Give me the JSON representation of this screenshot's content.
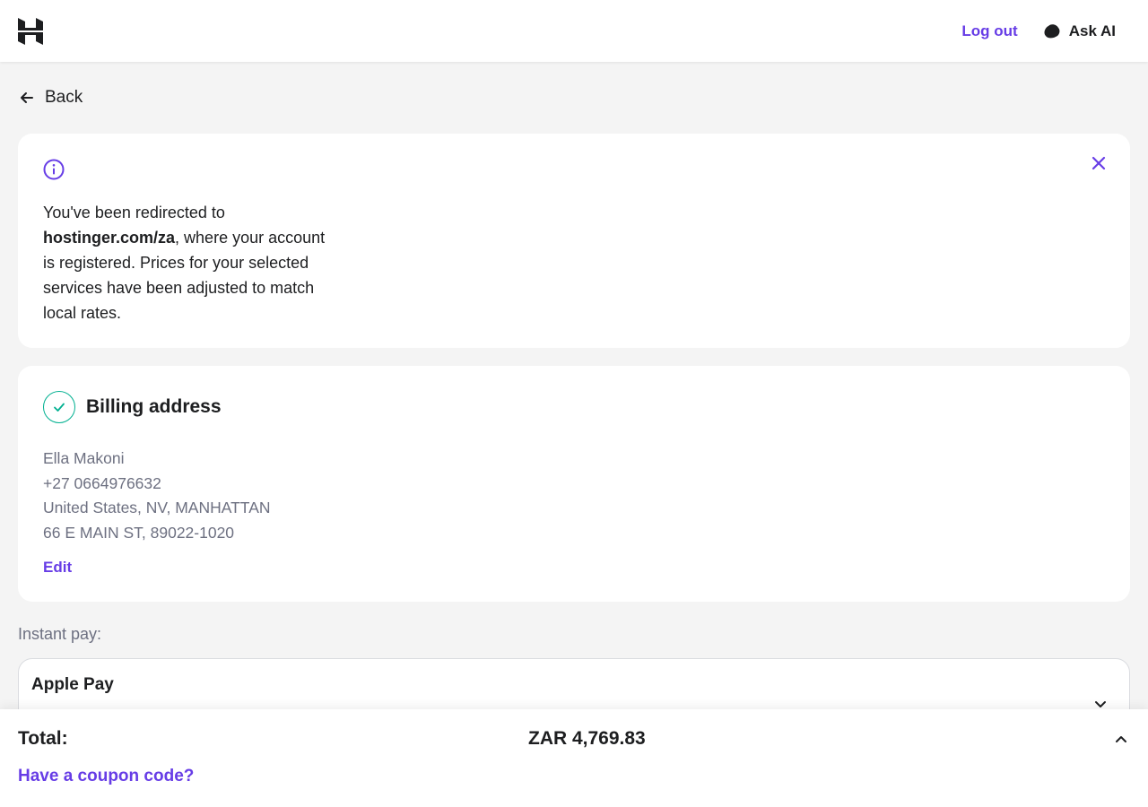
{
  "header": {
    "logo_icon": "hostinger-logo-icon",
    "logout_label": "Log out",
    "ask_ai_label": "Ask AI",
    "ask_ai_icon": "ai-cloud-icon"
  },
  "nav": {
    "back_label": "Back",
    "back_icon": "arrow-left-icon"
  },
  "notice": {
    "icon": "info-icon",
    "close_icon": "close-icon",
    "text_before": "You've been redirected to ",
    "domain": "hostinger.com/za",
    "text_after": ", where your account is registered. Prices for your selected services have been adjusted to match local rates."
  },
  "billing": {
    "status_icon": "check-circle-icon",
    "title": "Billing address",
    "name": "Ella Makoni",
    "phone": "+27 0664976632",
    "location": "United States, NV, MANHATTAN",
    "street": "66 E MAIN ST, 89022-1020",
    "edit_label": "Edit"
  },
  "payment": {
    "section_label": "Instant pay:",
    "selected_method": "Apple Pay",
    "chevron_icon": "chevron-down-icon"
  },
  "summary": {
    "total_label": "Total:",
    "total_value": "ZAR 4,769.83",
    "coupon_label": "Have a coupon code?",
    "chevron_icon": "chevron-up-icon"
  },
  "colors": {
    "accent": "#673de6",
    "success": "#00b090",
    "text": "#1d1e20",
    "muted": "#6d7081",
    "background": "#f4f4f4"
  }
}
